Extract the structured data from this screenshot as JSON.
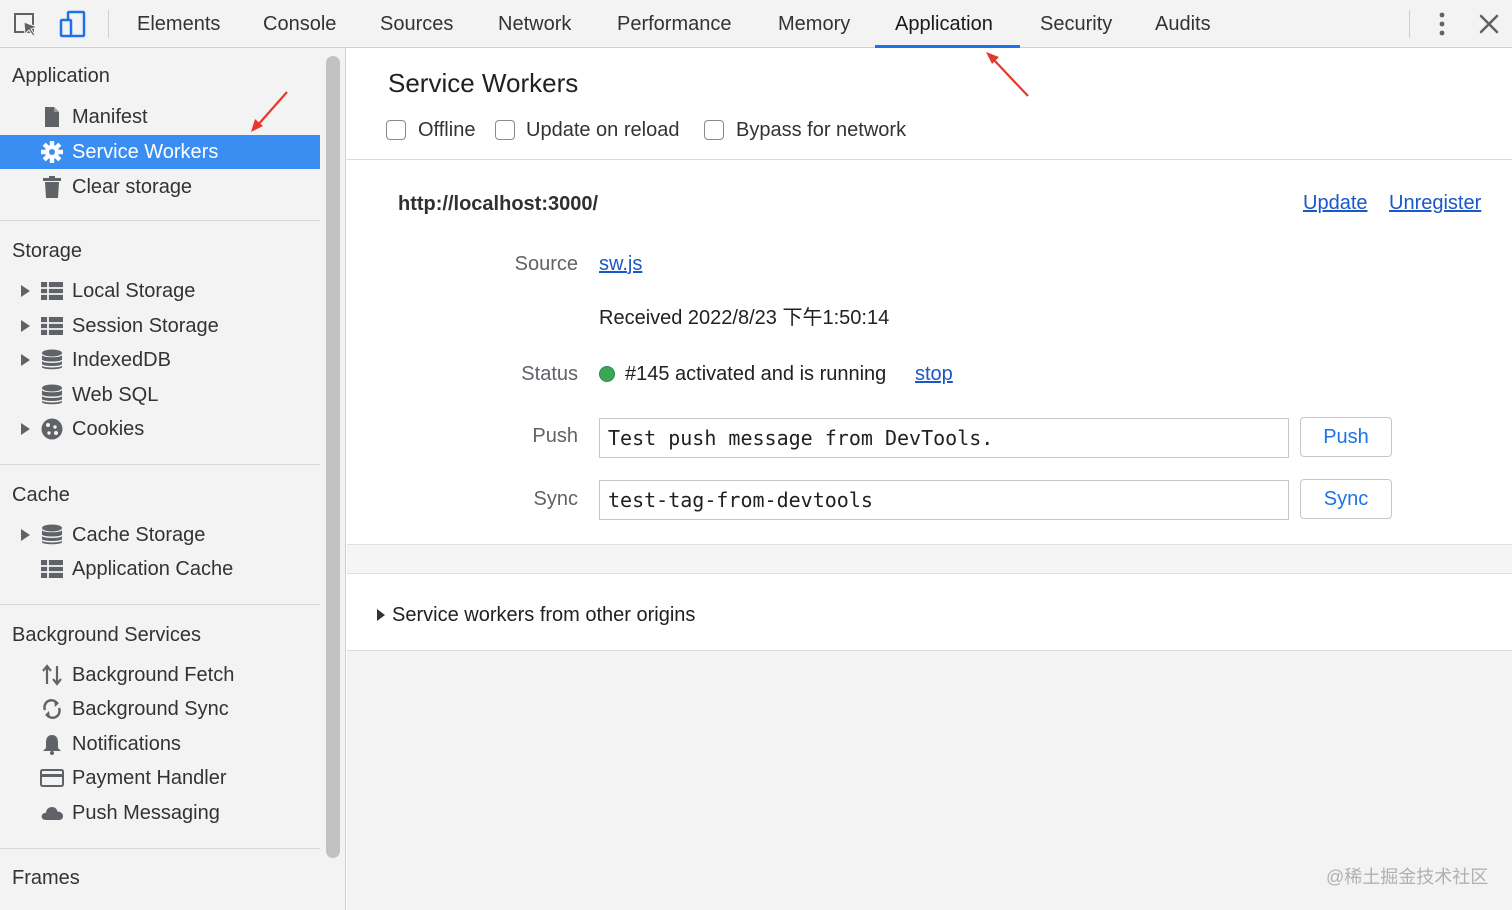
{
  "toolbar": {
    "tabs": [
      {
        "label": "Elements"
      },
      {
        "label": "Console"
      },
      {
        "label": "Sources"
      },
      {
        "label": "Network"
      },
      {
        "label": "Performance"
      },
      {
        "label": "Memory"
      },
      {
        "label": "Application"
      },
      {
        "label": "Security"
      },
      {
        "label": "Audits"
      }
    ],
    "active_tab": "Application",
    "accent_color": "#1a73e8"
  },
  "sidebar": {
    "selected_color": "#3a8ef2",
    "sections": {
      "application": {
        "title": "Application",
        "items": [
          {
            "label": "Manifest",
            "icon": "file-icon"
          },
          {
            "label": "Service Workers",
            "icon": "gear-icon",
            "selected": true
          },
          {
            "label": "Clear storage",
            "icon": "trash-icon"
          }
        ]
      },
      "storage": {
        "title": "Storage",
        "items": [
          {
            "label": "Local Storage",
            "icon": "grid-icon",
            "expandable": true
          },
          {
            "label": "Session Storage",
            "icon": "grid-icon",
            "expandable": true
          },
          {
            "label": "IndexedDB",
            "icon": "database-icon",
            "expandable": true
          },
          {
            "label": "Web SQL",
            "icon": "database-icon"
          },
          {
            "label": "Cookies",
            "icon": "cookie-icon",
            "expandable": true
          }
        ]
      },
      "cache": {
        "title": "Cache",
        "items": [
          {
            "label": "Cache Storage",
            "icon": "database-icon",
            "expandable": true
          },
          {
            "label": "Application Cache",
            "icon": "grid-icon"
          }
        ]
      },
      "background": {
        "title": "Background Services",
        "items": [
          {
            "label": "Background Fetch",
            "icon": "up-down-arrows-icon"
          },
          {
            "label": "Background Sync",
            "icon": "sync-icon"
          },
          {
            "label": "Notifications",
            "icon": "bell-icon"
          },
          {
            "label": "Payment Handler",
            "icon": "card-icon"
          },
          {
            "label": "Push Messaging",
            "icon": "cloud-icon"
          }
        ]
      },
      "frames": {
        "title": "Frames"
      }
    }
  },
  "main": {
    "title": "Service Workers",
    "options": [
      {
        "label": "Offline",
        "checked": false
      },
      {
        "label": "Update on reload",
        "checked": false
      },
      {
        "label": "Bypass for network",
        "checked": false
      }
    ],
    "worker": {
      "origin": "http://localhost:3000/",
      "update_label": "Update",
      "unregister_label": "Unregister",
      "source_label": "Source",
      "source_file": "sw.js",
      "received": "Received 2022/8/23 下午1:50:14",
      "status_label": "Status",
      "status_text": "#145 activated and is running",
      "status_color": "#3aa757",
      "stop_label": "stop",
      "push_label": "Push",
      "push_value": "Test push message from DevTools.",
      "push_button": "Push",
      "sync_label": "Sync",
      "sync_value": "test-tag-from-devtools",
      "sync_button": "Sync"
    },
    "other_origins": "Service workers from other origins"
  },
  "watermark": "@稀土掘金技术社区"
}
